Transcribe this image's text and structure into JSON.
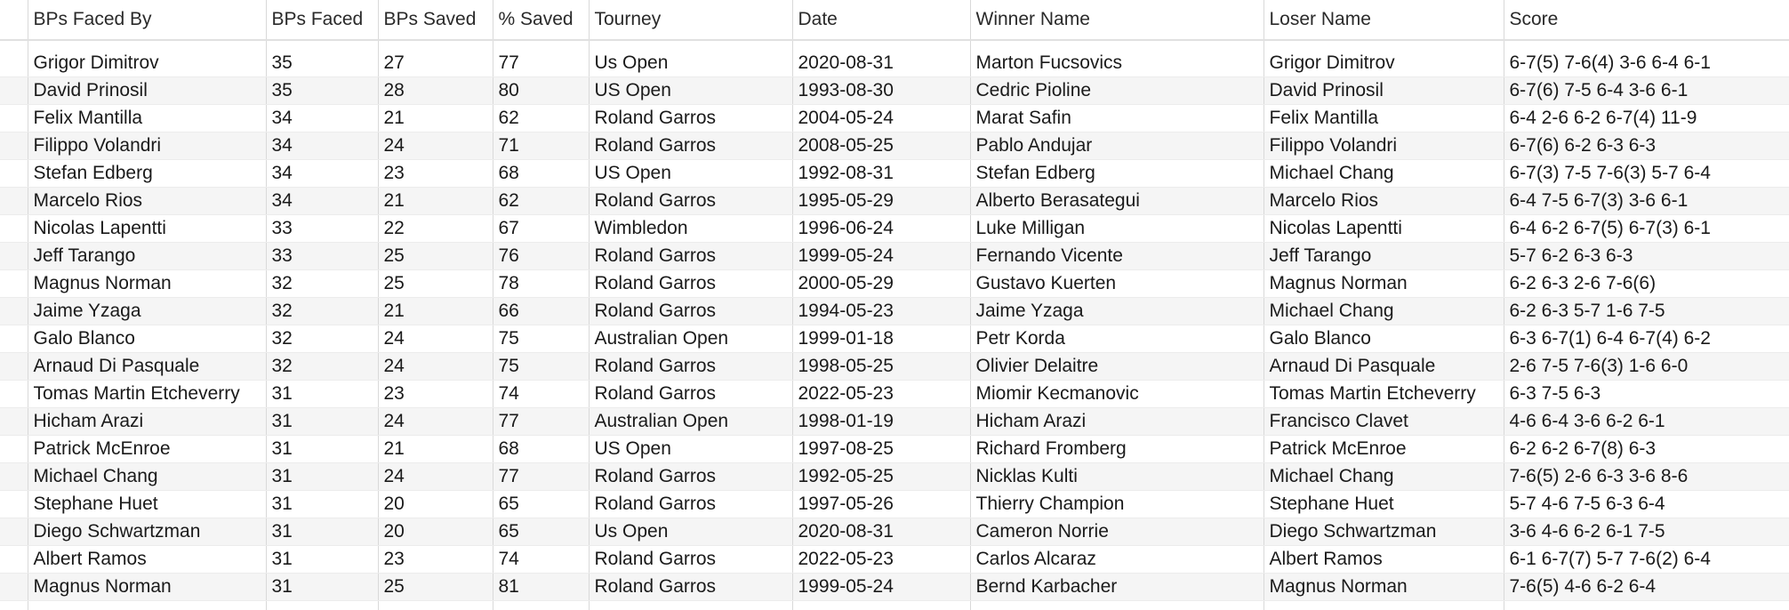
{
  "columns": [
    "BPs Faced By",
    "BPs Faced",
    "BPs Saved",
    "% Saved",
    "Tourney",
    "Date",
    "Winner Name",
    "Loser Name",
    "Score"
  ],
  "rows": [
    [
      "Grigor Dimitrov",
      "35",
      "27",
      "77",
      "Us Open",
      "2020-08-31",
      "Marton Fucsovics",
      "Grigor Dimitrov",
      "6-7(5) 7-6(4) 3-6 6-4 6-1"
    ],
    [
      "David Prinosil",
      "35",
      "28",
      "80",
      "US Open",
      "1993-08-30",
      "Cedric Pioline",
      "David Prinosil",
      "6-7(6) 7-5 6-4 3-6 6-1"
    ],
    [
      "Felix Mantilla",
      "34",
      "21",
      "62",
      "Roland Garros",
      "2004-05-24",
      "Marat Safin",
      "Felix Mantilla",
      "6-4 2-6 6-2 6-7(4) 11-9"
    ],
    [
      "Filippo Volandri",
      "34",
      "24",
      "71",
      "Roland Garros",
      "2008-05-25",
      "Pablo Andujar",
      "Filippo Volandri",
      "6-7(6) 6-2 6-3 6-3"
    ],
    [
      "Stefan Edberg",
      "34",
      "23",
      "68",
      "US Open",
      "1992-08-31",
      "Stefan Edberg",
      "Michael Chang",
      "6-7(3) 7-5 7-6(3) 5-7 6-4"
    ],
    [
      "Marcelo Rios",
      "34",
      "21",
      "62",
      "Roland Garros",
      "1995-05-29",
      "Alberto Berasategui",
      "Marcelo Rios",
      "6-4 7-5 6-7(3) 3-6 6-1"
    ],
    [
      "Nicolas Lapentti",
      "33",
      "22",
      "67",
      "Wimbledon",
      "1996-06-24",
      "Luke Milligan",
      "Nicolas Lapentti",
      "6-4 6-2 6-7(5) 6-7(3) 6-1"
    ],
    [
      "Jeff Tarango",
      "33",
      "25",
      "76",
      "Roland Garros",
      "1999-05-24",
      "Fernando Vicente",
      "Jeff Tarango",
      "5-7 6-2 6-3 6-3"
    ],
    [
      "Magnus Norman",
      "32",
      "25",
      "78",
      "Roland Garros",
      "2000-05-29",
      "Gustavo Kuerten",
      "Magnus Norman",
      "6-2 6-3 2-6 7-6(6)"
    ],
    [
      "Jaime Yzaga",
      "32",
      "21",
      "66",
      "Roland Garros",
      "1994-05-23",
      "Jaime Yzaga",
      "Michael Chang",
      "6-2 6-3 5-7 1-6 7-5"
    ],
    [
      "Galo Blanco",
      "32",
      "24",
      "75",
      "Australian Open",
      "1999-01-18",
      "Petr Korda",
      "Galo Blanco",
      "6-3 6-7(1) 6-4 6-7(4) 6-2"
    ],
    [
      "Arnaud Di Pasquale",
      "32",
      "24",
      "75",
      "Roland Garros",
      "1998-05-25",
      "Olivier Delaitre",
      "Arnaud Di Pasquale",
      "2-6 7-5 7-6(3) 1-6 6-0"
    ],
    [
      "Tomas Martin Etcheverry",
      "31",
      "23",
      "74",
      "Roland Garros",
      "2022-05-23",
      "Miomir Kecmanovic",
      "Tomas Martin Etcheverry",
      "6-3 7-5 6-3"
    ],
    [
      "Hicham Arazi",
      "31",
      "24",
      "77",
      "Australian Open",
      "1998-01-19",
      "Hicham Arazi",
      "Francisco Clavet",
      "4-6 6-4 3-6 6-2 6-1"
    ],
    [
      "Patrick McEnroe",
      "31",
      "21",
      "68",
      "US Open",
      "1997-08-25",
      "Richard Fromberg",
      "Patrick McEnroe",
      "6-2 6-2 6-7(8) 6-3"
    ],
    [
      "Michael Chang",
      "31",
      "24",
      "77",
      "Roland Garros",
      "1992-05-25",
      "Nicklas Kulti",
      "Michael Chang",
      "7-6(5) 2-6 6-3 3-6 8-6"
    ],
    [
      "Stephane Huet",
      "31",
      "20",
      "65",
      "Roland Garros",
      "1997-05-26",
      "Thierry Champion",
      "Stephane Huet",
      "5-7 4-6 7-5 6-3 6-4"
    ],
    [
      "Diego Schwartzman",
      "31",
      "20",
      "65",
      "Us Open",
      "2020-08-31",
      "Cameron Norrie",
      "Diego Schwartzman",
      "3-6 4-6 6-2 6-1 7-5"
    ],
    [
      "Albert Ramos",
      "31",
      "23",
      "74",
      "Roland Garros",
      "2022-05-23",
      "Carlos Alcaraz",
      "Albert Ramos",
      "6-1 6-7(7) 5-7 7-6(2) 6-4"
    ],
    [
      "Magnus Norman",
      "31",
      "25",
      "81",
      "Roland Garros",
      "1999-05-24",
      "Bernd Karbacher",
      "Magnus Norman",
      "7-6(5) 4-6 6-2 6-4"
    ]
  ]
}
